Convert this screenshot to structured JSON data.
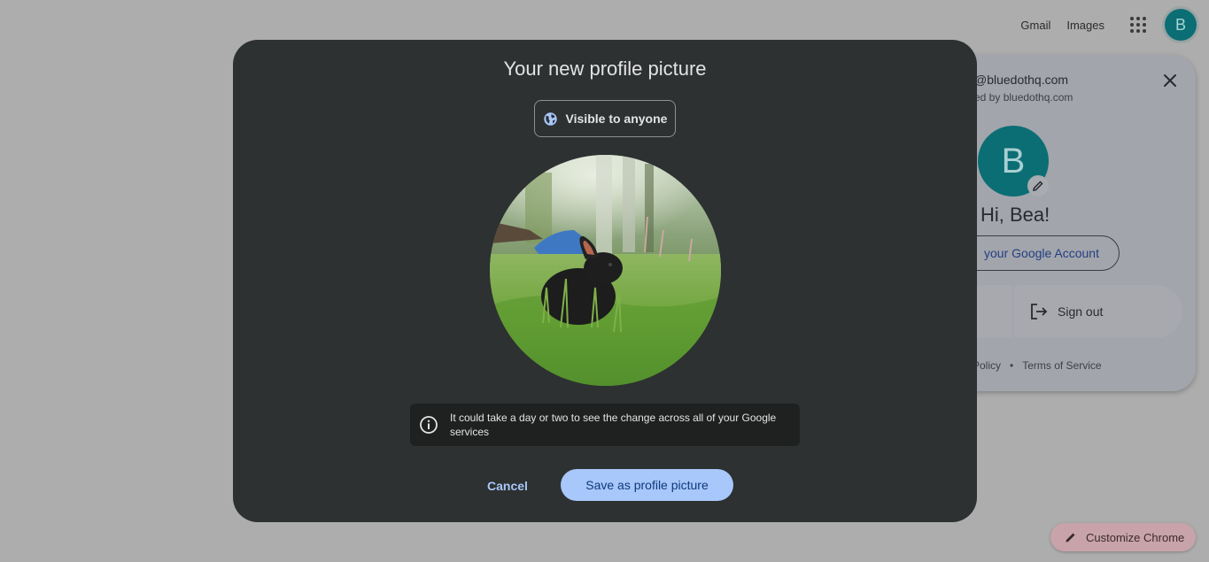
{
  "topbar": {
    "gmail_label": "Gmail",
    "images_label": "Images",
    "avatar_letter": "B"
  },
  "account_panel": {
    "email": "@bluedothq.com",
    "managed_by": "ed by bluedothq.com",
    "avatar_letter": "B",
    "greeting": "Hi, Bea!",
    "manage_account_label": "your Google Account",
    "sign_out_label": "Sign out",
    "footer": {
      "privacy_label": "Policy",
      "separator": "•",
      "terms_label": "Terms of Service"
    }
  },
  "modal": {
    "title": "Your new profile picture",
    "visibility_label": "Visible to anyone",
    "notice_text": "It could take a day or two to see the change across all of your Google services",
    "cancel_label": "Cancel",
    "save_label": "Save as profile picture",
    "photo_description": "Black rabbit sitting in green grass with a forest background"
  },
  "customize_chrome": {
    "label": "Customize Chrome"
  },
  "colors": {
    "backdrop": "#adadad",
    "modal_bg": "#2d3131",
    "accent": "#a8c7fa",
    "avatar_teal": "#0b6e74"
  }
}
